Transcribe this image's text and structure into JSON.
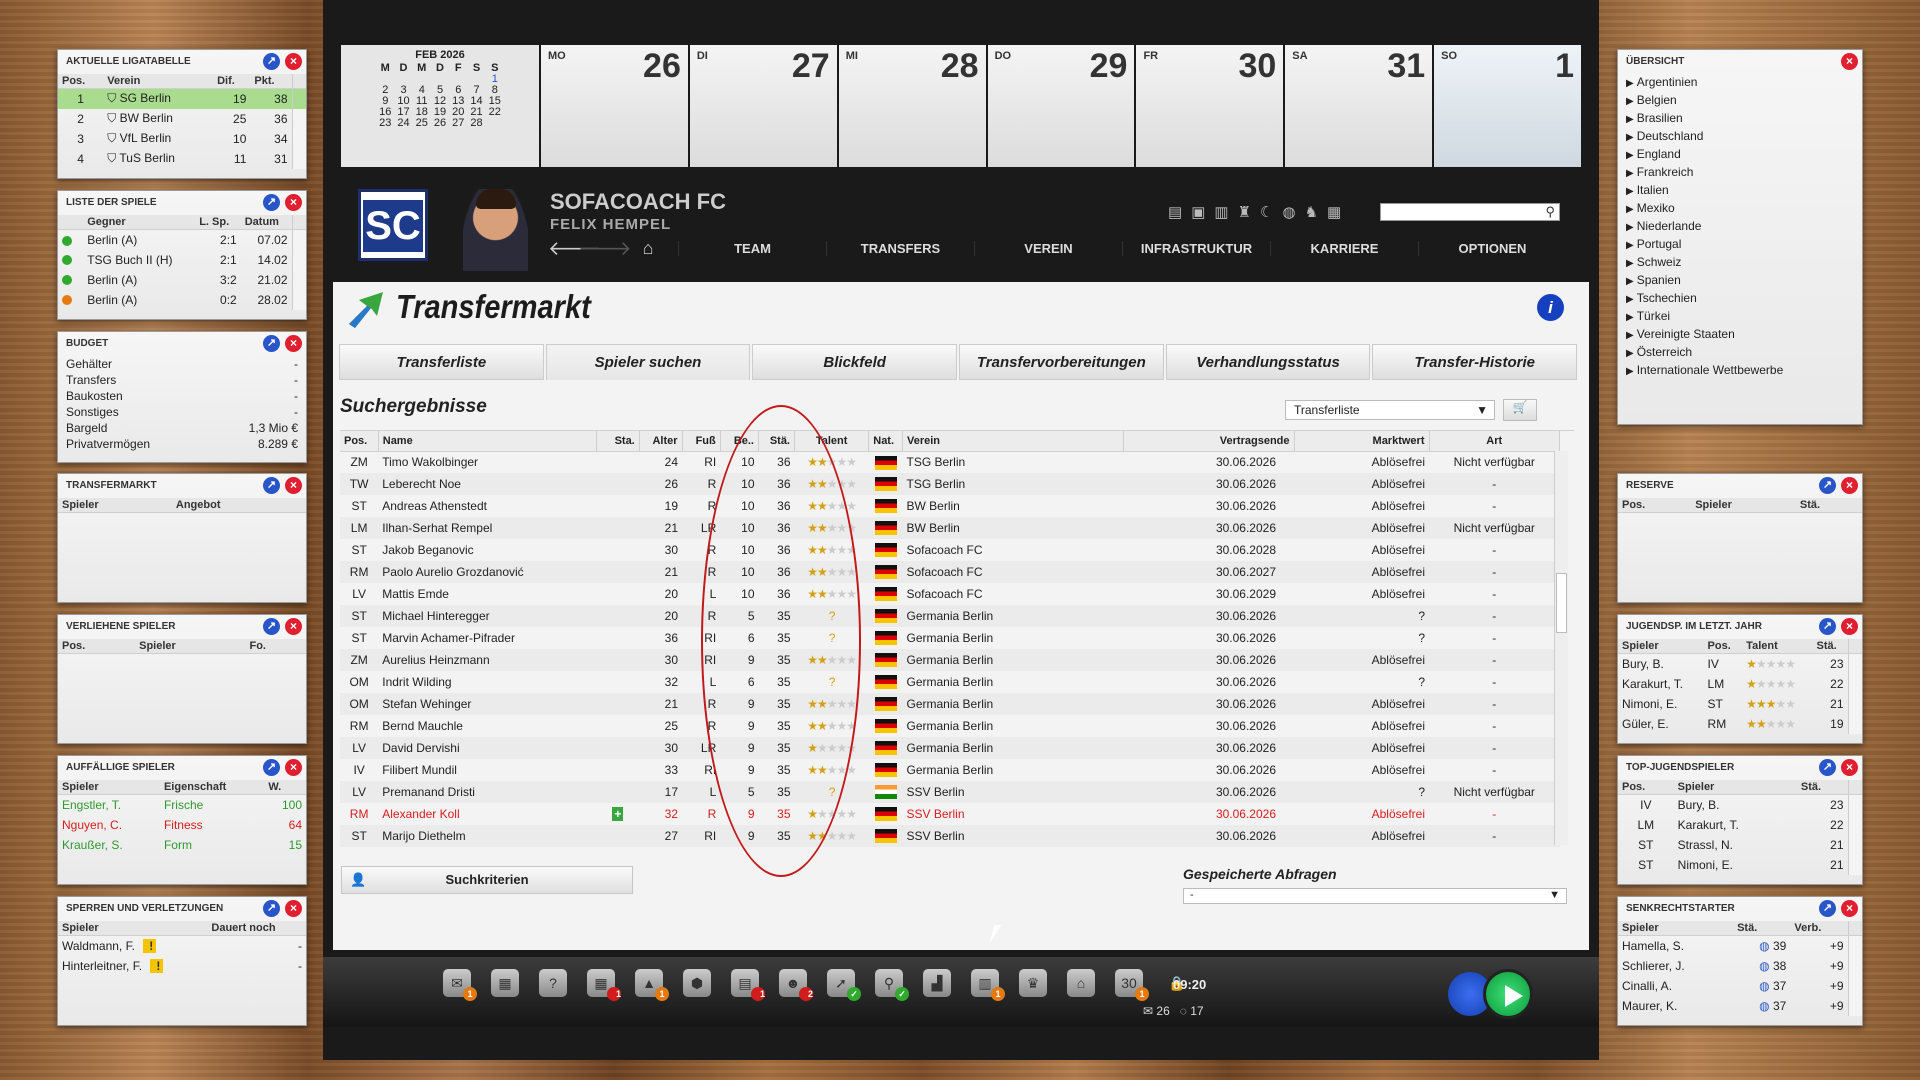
{
  "left": {
    "liga": {
      "title": "AKTUELLE LIGATABELLE",
      "cols": [
        "Pos.",
        "Verein",
        "Dif.",
        "Pkt."
      ],
      "rows": [
        [
          "1",
          "SG Berlin",
          "19",
          "38"
        ],
        [
          "2",
          "BW Berlin",
          "25",
          "36"
        ],
        [
          "3",
          "VfL Berlin",
          "10",
          "34"
        ],
        [
          "4",
          "TuS Berlin",
          "11",
          "31"
        ]
      ]
    },
    "spiele": {
      "title": "LISTE DER SPIELE",
      "cols": [
        "Gegner",
        "L. Sp.",
        "Datum"
      ],
      "rows": [
        [
          "Berlin (A)",
          "2:1",
          "07.02"
        ],
        [
          "TSG Buch II (H)",
          "2:1",
          "14.02"
        ],
        [
          "Berlin (A)",
          "3:2",
          "21.02"
        ],
        [
          "Berlin (A)",
          "0:2",
          "28.02"
        ]
      ],
      "dot_colors": [
        "#2faa2f",
        "#2faa2f",
        "#2faa2f",
        "#e57a10"
      ]
    },
    "budget": {
      "title": "BUDGET",
      "rows": [
        [
          "Gehälter",
          "-"
        ],
        [
          "Transfers",
          "-"
        ],
        [
          "Baukosten",
          "-"
        ],
        [
          "Sonstiges",
          "-"
        ],
        [
          "Bargeld",
          "1,3 Mio €"
        ],
        [
          "Privatvermögen",
          "8.289 €"
        ]
      ]
    },
    "transfermarkt": {
      "title": "TRANSFERMARKT",
      "cols": [
        "Spieler",
        "Angebot"
      ]
    },
    "verliehen": {
      "title": "VERLIEHENE SPIELER",
      "cols": [
        "Pos.",
        "Spieler",
        "Fo."
      ]
    },
    "auffaellig": {
      "title": "AUFFÄLLIGE SPIELER",
      "cols": [
        "Spieler",
        "Eigenschaft",
        "W."
      ],
      "rows": [
        [
          "Engstler, T.",
          "Frische",
          "100"
        ],
        [
          "Nguyen, C.",
          "Fitness",
          "64"
        ],
        [
          "Kraußer, S.",
          "Form",
          "15"
        ]
      ]
    },
    "sperren": {
      "title": "SPERREN UND VERLETZUNGEN",
      "cols": [
        "Spieler",
        "Dauert noch"
      ],
      "rows": [
        [
          "Waldmann, F.",
          "-"
        ],
        [
          "Hinterleitner, F.",
          "-"
        ]
      ]
    }
  },
  "calendar": {
    "month": "FEB 2026",
    "weekdays": [
      "M",
      "D",
      "M",
      "D",
      "F",
      "S",
      "S"
    ],
    "weeks": [
      [
        "",
        "",
        "",
        "",
        "",
        "",
        "1"
      ],
      [
        "2",
        "3",
        "4",
        "5",
        "6",
        "7",
        "8"
      ],
      [
        "9",
        "10",
        "11",
        "12",
        "13",
        "14",
        "15"
      ],
      [
        "16",
        "17",
        "18",
        "19",
        "20",
        "21",
        "22"
      ],
      [
        "23",
        "24",
        "25",
        "26",
        "27",
        "28",
        ""
      ]
    ],
    "days": [
      [
        "MO",
        "26"
      ],
      [
        "DI",
        "27"
      ],
      [
        "MI",
        "28"
      ],
      [
        "DO",
        "29"
      ],
      [
        "FR",
        "30"
      ],
      [
        "SA",
        "31"
      ],
      [
        "SO",
        "1"
      ]
    ]
  },
  "club": {
    "logo": "SC",
    "name": "SOFACOACH FC",
    "manager": "FELIX HEMPEL"
  },
  "nav": {
    "items": [
      "TEAM",
      "TRANSFERS",
      "VEREIN",
      "INFRASTRUKTUR",
      "KARRIERE",
      "OPTIONEN"
    ],
    "back": "🡐",
    "forward": "🡒",
    "home": "⌂"
  },
  "page": {
    "title": "Transfermarkt",
    "info": "i",
    "tabs": [
      "Transferliste",
      "Spieler suchen",
      "Blickfeld",
      "Transfervorbereitungen",
      "Verhandlungsstatus",
      "Transfer-Historie"
    ],
    "section": "Suchergebnisse",
    "dropdown": "Transferliste",
    "cols": [
      "Pos.",
      "Name",
      "Sta.",
      "Alter",
      "Fuß",
      "Be..",
      "Stä.",
      "Talent",
      "Nat.",
      "Verein",
      "Vertragsende",
      "Marktwert",
      "Art"
    ],
    "rows": [
      [
        "ZM",
        "Timo Wakolbinger",
        "",
        "24",
        "RI",
        "10",
        "36",
        2,
        "de",
        "TSG Berlin",
        "30.06.2026",
        "Ablösefrei",
        "Nicht verfügbar"
      ],
      [
        "TW",
        "Leberecht Noe",
        "",
        "26",
        "R",
        "10",
        "36",
        2,
        "de",
        "TSG Berlin",
        "30.06.2026",
        "Ablösefrei",
        "-"
      ],
      [
        "ST",
        "Andreas Athenstedt",
        "",
        "19",
        "R",
        "10",
        "36",
        2,
        "de",
        "BW Berlin",
        "30.06.2026",
        "Ablösefrei",
        "-"
      ],
      [
        "LM",
        "Ilhan-Serhat Rempel",
        "",
        "21",
        "LR",
        "10",
        "36",
        2,
        "de",
        "BW Berlin",
        "30.06.2026",
        "Ablösefrei",
        "Nicht verfügbar"
      ],
      [
        "ST",
        "Jakob Beganovic",
        "",
        "30",
        "R",
        "10",
        "36",
        2,
        "de",
        "Sofacoach FC",
        "30.06.2028",
        "Ablösefrei",
        "-"
      ],
      [
        "RM",
        "Paolo Aurelio Grozdanović",
        "",
        "21",
        "R",
        "10",
        "36",
        2,
        "de",
        "Sofacoach FC",
        "30.06.2027",
        "Ablösefrei",
        "-"
      ],
      [
        "LV",
        "Mattis Emde",
        "",
        "20",
        "L",
        "10",
        "36",
        2,
        "de",
        "Sofacoach FC",
        "30.06.2029",
        "Ablösefrei",
        "-"
      ],
      [
        "ST",
        "Michael Hinteregger",
        "",
        "20",
        "R",
        "5",
        "35",
        "?",
        "de",
        "Germania Berlin",
        "30.06.2026",
        "?",
        "-"
      ],
      [
        "ST",
        "Marvin Achamer-Pifrader",
        "",
        "36",
        "RI",
        "6",
        "35",
        "?",
        "de",
        "Germania Berlin",
        "30.06.2026",
        "?",
        "-"
      ],
      [
        "ZM",
        "Aurelius Heinzmann",
        "",
        "30",
        "RI",
        "9",
        "35",
        2,
        "de",
        "Germania Berlin",
        "30.06.2026",
        "Ablösefrei",
        "-"
      ],
      [
        "OM",
        "Indrit Wilding",
        "",
        "32",
        "L",
        "6",
        "35",
        "?",
        "de",
        "Germania Berlin",
        "30.06.2026",
        "?",
        "-"
      ],
      [
        "OM",
        "Stefan Wehinger",
        "",
        "21",
        "R",
        "9",
        "35",
        2,
        "de",
        "Germania Berlin",
        "30.06.2026",
        "Ablösefrei",
        "-"
      ],
      [
        "RM",
        "Bernd Mauchle",
        "",
        "25",
        "R",
        "9",
        "35",
        2,
        "de",
        "Germania Berlin",
        "30.06.2026",
        "Ablösefrei",
        "-"
      ],
      [
        "LV",
        "David Dervishi",
        "",
        "30",
        "LR",
        "9",
        "35",
        1,
        "de",
        "Germania Berlin",
        "30.06.2026",
        "Ablösefrei",
        "-"
      ],
      [
        "IV",
        "Filibert Mundil",
        "",
        "33",
        "RI",
        "9",
        "35",
        2,
        "de",
        "Germania Berlin",
        "30.06.2026",
        "Ablösefrei",
        "-"
      ],
      [
        "LV",
        "Premanand Dristi",
        "",
        "17",
        "L",
        "5",
        "35",
        "?",
        "in",
        "SSV Berlin",
        "30.06.2026",
        "?",
        "Nicht verfügbar"
      ],
      [
        "RM",
        "Alexander Koll",
        "+",
        "32",
        "R",
        "9",
        "35",
        1,
        "de",
        "SSV Berlin",
        "30.06.2026",
        "Ablösefrei",
        "-"
      ],
      [
        "ST",
        "Marijo Diethelm",
        "",
        "27",
        "RI",
        "9",
        "35",
        2,
        "de",
        "SSV Berlin",
        "30.06.2026",
        "Ablösefrei",
        "-"
      ]
    ],
    "search_btn": "Suchkriterien",
    "saved_label": "Gespeicherte Abfragen",
    "saved_value": "-"
  },
  "bottom": {
    "time": "09:20",
    "mail": "26",
    "msgs": "17"
  },
  "right": {
    "uebersicht": {
      "title": "ÜBERSICHT",
      "items": [
        "Argentinien",
        "Belgien",
        "Brasilien",
        "Deutschland",
        "England",
        "Frankreich",
        "Italien",
        "Mexiko",
        "Niederlande",
        "Portugal",
        "Schweiz",
        "Spanien",
        "Tschechien",
        "Türkei",
        "Vereinigte Staaten",
        "Österreich",
        "Internationale Wettbewerbe"
      ]
    },
    "reserve": {
      "title": "RESERVE",
      "cols": [
        "Pos.",
        "Spieler",
        "Stä."
      ]
    },
    "jugend": {
      "title": "JUGENDSP. IM LETZT. JAHR",
      "cols": [
        "Spieler",
        "Pos.",
        "Talent",
        "Stä."
      ],
      "rows": [
        [
          "Bury, B.",
          "IV",
          1,
          "23"
        ],
        [
          "Karakurt, T.",
          "LM",
          1,
          "22"
        ],
        [
          "Nimoni, E.",
          "ST",
          3,
          "21"
        ],
        [
          "Güler, E.",
          "RM",
          2,
          "19"
        ]
      ]
    },
    "top": {
      "title": "TOP-JUGENDSPIELER",
      "cols": [
        "Pos.",
        "Spieler",
        "Stä."
      ],
      "rows": [
        [
          "IV",
          "Bury, B.",
          "23"
        ],
        [
          "LM",
          "Karakurt, T.",
          "22"
        ],
        [
          "ST",
          "Strassl, N.",
          "21"
        ],
        [
          "ST",
          "Nimoni, E.",
          "21"
        ]
      ]
    },
    "senk": {
      "title": "SENKRECHTSTARTER",
      "cols": [
        "Spieler",
        "Stä.",
        "Verb."
      ],
      "rows": [
        [
          "Hamella, S.",
          "39",
          "+9"
        ],
        [
          "Schlierer, J.",
          "38",
          "+9"
        ],
        [
          "Cinalli, A.",
          "37",
          "+9"
        ],
        [
          "Maurer, K.",
          "37",
          "+9"
        ]
      ]
    }
  }
}
